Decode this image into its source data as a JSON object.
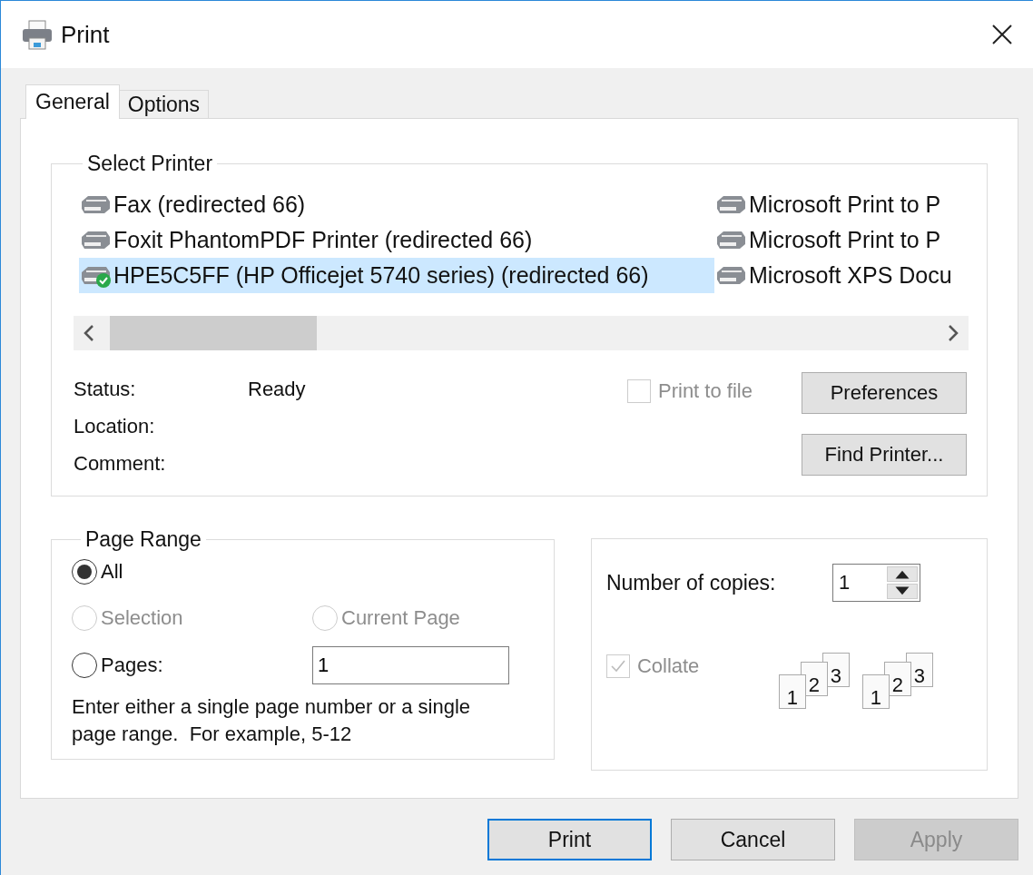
{
  "window": {
    "title": "Print"
  },
  "tabs": [
    {
      "label": "General",
      "selected": true
    },
    {
      "label": "Options",
      "selected": false
    }
  ],
  "select_printer": {
    "title": "Select Printer",
    "columns": [
      {
        "items": [
          {
            "name": "Fax (redirected 66)",
            "selected": false,
            "default": false
          },
          {
            "name": "Foxit PhantomPDF Printer (redirected 66)",
            "selected": false,
            "default": false
          },
          {
            "name": "HPE5C5FF (HP Officejet 5740 series) (redirected 66)",
            "selected": true,
            "default": true
          }
        ]
      },
      {
        "items": [
          {
            "name": "Microsoft Print to P",
            "selected": false,
            "default": false
          },
          {
            "name": "Microsoft Print to P",
            "selected": false,
            "default": false
          },
          {
            "name": "Microsoft XPS Docu",
            "selected": false,
            "default": false
          }
        ]
      }
    ],
    "info": [
      {
        "label": "Status:",
        "value": "Ready"
      },
      {
        "label": "Location:"
      },
      {
        "label": "Comment:"
      }
    ],
    "print_to_file": {
      "label": "Print to file",
      "checked": false,
      "disabled": true
    },
    "buttons": [
      "Preferences",
      "Find Printer..."
    ]
  },
  "page_range": {
    "title": "Page Range",
    "options": [
      {
        "label": "All",
        "selected": true,
        "disabled": false
      },
      {
        "label": "Selection",
        "selected": false,
        "disabled": true
      },
      {
        "label": "Current Page",
        "selected": false,
        "disabled": true
      },
      {
        "label": "Pages:",
        "selected": false,
        "disabled": false
      }
    ],
    "pages_value": "1",
    "hint": "Enter either a single page number or a single page range.  For example, 5-12"
  },
  "copies": {
    "label": "Number of copies:",
    "value": "1",
    "collate": {
      "label": "Collate",
      "checked": true,
      "disabled": true
    },
    "collate_pages": [
      [
        "1",
        "2",
        "3"
      ],
      [
        "1",
        "2",
        "3"
      ]
    ]
  },
  "buttons": [
    {
      "label": "Print",
      "default": true,
      "disabled": false
    },
    {
      "label": "Cancel",
      "default": false,
      "disabled": false
    },
    {
      "label": "Apply",
      "default": false,
      "disabled": true
    }
  ]
}
